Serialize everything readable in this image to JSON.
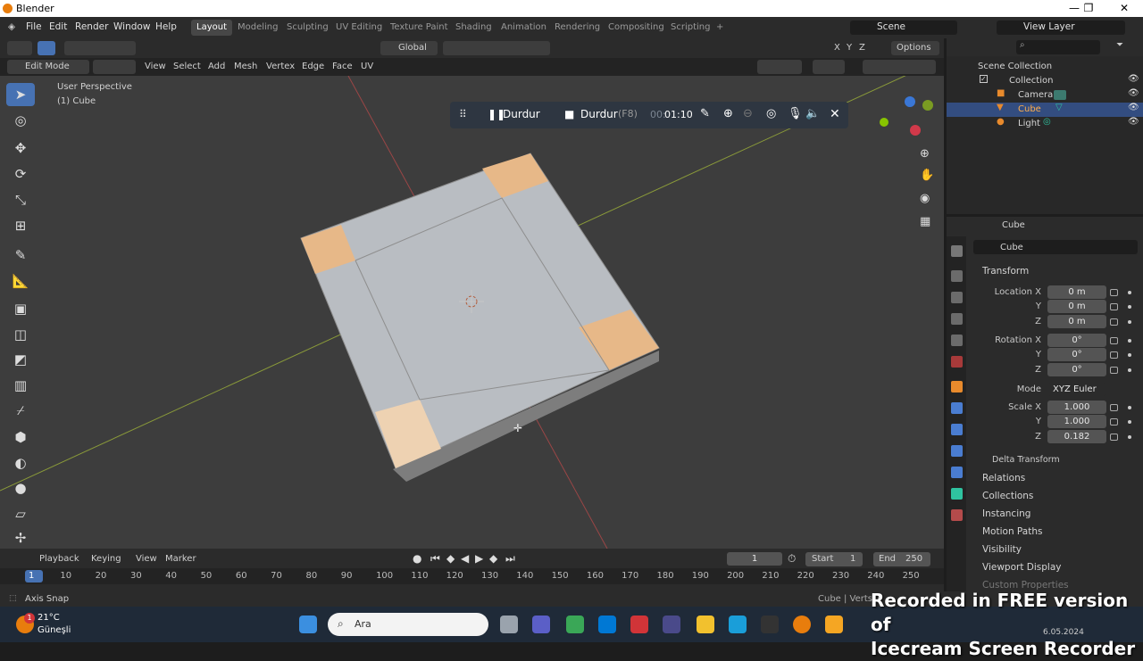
{
  "window": {
    "title": "Blender",
    "controls": [
      "—",
      "❐",
      "✕"
    ]
  },
  "menu": {
    "items": [
      "File",
      "Edit",
      "Render",
      "Window",
      "Help"
    ]
  },
  "workspaces": [
    "Layout",
    "Modeling",
    "Sculpting",
    "UV Editing",
    "Texture Paint",
    "Shading",
    "Animation",
    "Rendering",
    "Compositing",
    "Scripting",
    "+"
  ],
  "scene": {
    "name": "Scene",
    "view_layer": "View Layer"
  },
  "header": {
    "orientation": "Global",
    "options": "Options",
    "axes": [
      "X",
      "Y",
      "Z"
    ],
    "mode": "Edit Mode",
    "menus": [
      "View",
      "Select",
      "Add",
      "Mesh",
      "Vertex",
      "Edge",
      "Face",
      "UV"
    ]
  },
  "viewport": {
    "perspective": "User Perspective",
    "object": "(1) Cube"
  },
  "recorder": {
    "pause_label": "Durdur",
    "stop_label": "Durdur",
    "stop_hotkey": "(F8)",
    "time_prefix": "00:",
    "time": "01:10"
  },
  "outliner": {
    "root": "Scene Collection",
    "items": [
      {
        "label": "Collection"
      },
      {
        "label": "Camera"
      },
      {
        "label": "Cube"
      },
      {
        "label": "Light"
      }
    ]
  },
  "properties": {
    "object_name": "Cube",
    "datablock": "Cube",
    "transform_label": "Transform",
    "location": {
      "label": "Location X",
      "x": "0 m",
      "y": "0 m",
      "z": "0 m"
    },
    "rotation": {
      "label": "Rotation X",
      "x": "0°",
      "y": "0°",
      "z": "0°"
    },
    "mode_label": "Mode",
    "mode_value": "XYZ Euler",
    "scale": {
      "label": "Scale X",
      "x": "1.000",
      "y": "1.000",
      "z": "0.182"
    },
    "axis_y": "Y",
    "axis_z": "Z",
    "subpanels": [
      "Delta Transform"
    ],
    "panels": [
      "Relations",
      "Collections",
      "Instancing",
      "Motion Paths",
      "Visibility",
      "Viewport Display",
      "Custom Properties"
    ]
  },
  "timeline": {
    "menus": [
      "Playback",
      "Keying",
      "View",
      "Marker"
    ],
    "current_frame": "1",
    "start_label": "Start",
    "start": "1",
    "end_label": "End",
    "end": "250",
    "ticks": [
      "1",
      "10",
      "20",
      "30",
      "40",
      "50",
      "60",
      "70",
      "80",
      "90",
      "100",
      "110",
      "120",
      "130",
      "140",
      "150",
      "160",
      "170",
      "180",
      "190",
      "200",
      "210",
      "220",
      "230",
      "240",
      "250"
    ]
  },
  "status": {
    "left": "Axis Snap",
    "right": "Cube | Verts:1"
  },
  "taskbar": {
    "temp": "21°C",
    "weather": "Güneşli",
    "search": "Ara",
    "date": "6.05.2024",
    "badge": "1"
  },
  "watermark": {
    "line1": "Recorded in FREE version of",
    "line2": "Icecream Screen Recorder"
  }
}
